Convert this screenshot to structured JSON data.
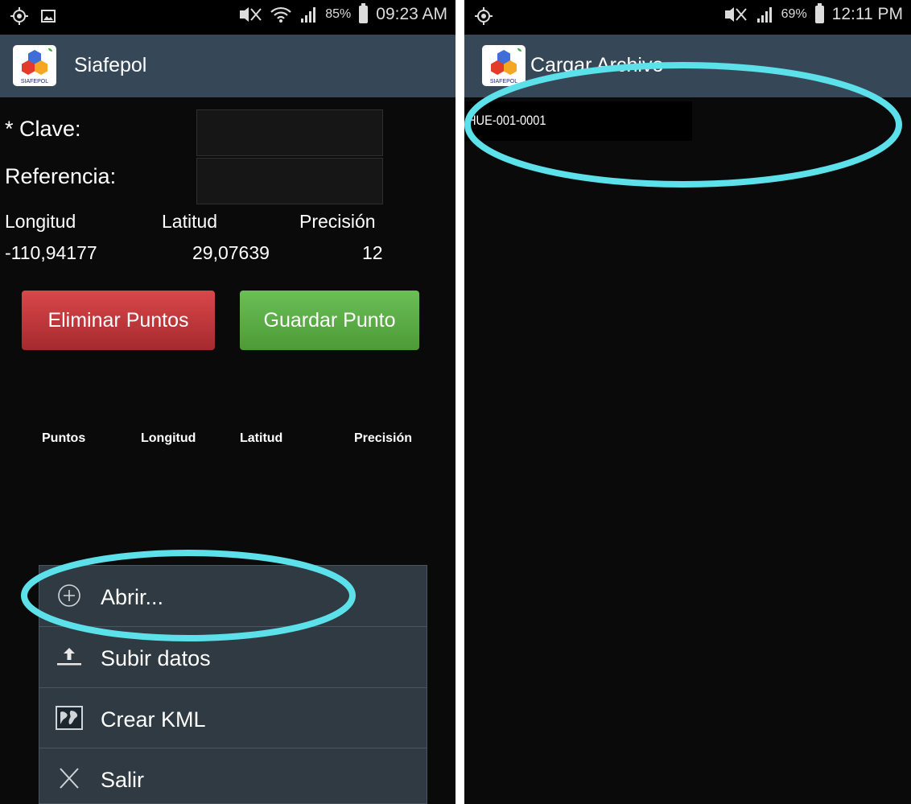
{
  "left": {
    "status": {
      "signal_percent": "85%",
      "time": "09:23 AM"
    },
    "app_title": "Siafepol",
    "logo_text": "SIAFEPOL",
    "form": {
      "clave_label": "* Clave:",
      "referencia_label": "Referencia:",
      "clave_value": "",
      "referencia_value": ""
    },
    "gps": {
      "headers": [
        "Longitud",
        "Latitud",
        "Precisión"
      ],
      "values": [
        "-110,94177",
        "29,07639",
        "12"
      ]
    },
    "buttons": {
      "delete_label": "Eliminar Puntos",
      "save_label": "Guardar Punto"
    },
    "table_headers": [
      "Puntos",
      "Longitud",
      "Latitud",
      "Precisión"
    ],
    "menu": [
      {
        "label": "Abrir...",
        "icon": "add-circle-icon"
      },
      {
        "label": "Subir datos",
        "icon": "upload-icon"
      },
      {
        "label": "Crear KML",
        "icon": "map-icon"
      },
      {
        "label": "Salir",
        "icon": "close-icon"
      }
    ]
  },
  "right": {
    "status": {
      "signal_percent": "69%",
      "time": "12:11 PM"
    },
    "app_title": "Cargar Archivo",
    "logo_text": "SIAFEPOL",
    "files": [
      "HUE-001-0001"
    ]
  },
  "colors": {
    "actionbar": "#364858",
    "highlight": "#5ce1ea",
    "delete_button": "#c0383b",
    "save_button": "#5aad47",
    "menu_bg": "#2f3a42"
  }
}
